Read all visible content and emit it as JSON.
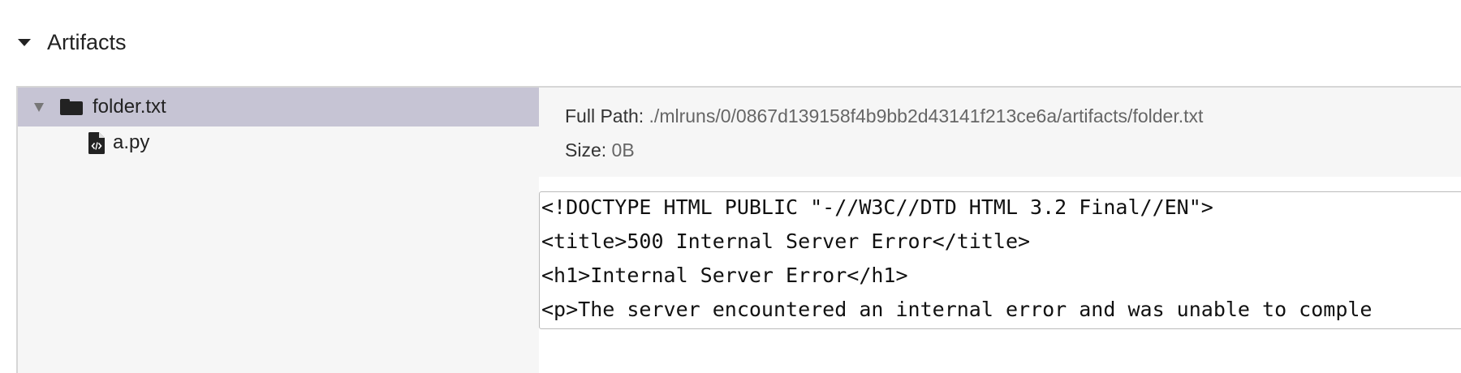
{
  "section": {
    "title": "Artifacts"
  },
  "tree": {
    "items": [
      {
        "label": "folder.txt",
        "type": "folder",
        "icon": "folder-icon",
        "expanded": true,
        "selected": true
      },
      {
        "label": "a.py",
        "type": "file",
        "icon": "file-code-icon",
        "selected": false
      }
    ]
  },
  "details": {
    "full_path_label": "Full Path:",
    "full_path_value": "./mlruns/0/0867d139158f4b9bb2d43141f213ce6a/artifacts/folder.txt",
    "size_label": "Size:",
    "size_value": "0B"
  },
  "preview": {
    "lines": [
      "<!DOCTYPE HTML PUBLIC \"-//W3C//DTD HTML 3.2 Final//EN\">",
      "<title>500 Internal Server Error</title>",
      "<h1>Internal Server Error</h1>",
      "<p>The server encountered an internal error and was unable to comple"
    ]
  },
  "colors": {
    "selected_row": "#c6c4d4",
    "pane_background": "#f6f6f6",
    "border": "#d6d6d6"
  }
}
